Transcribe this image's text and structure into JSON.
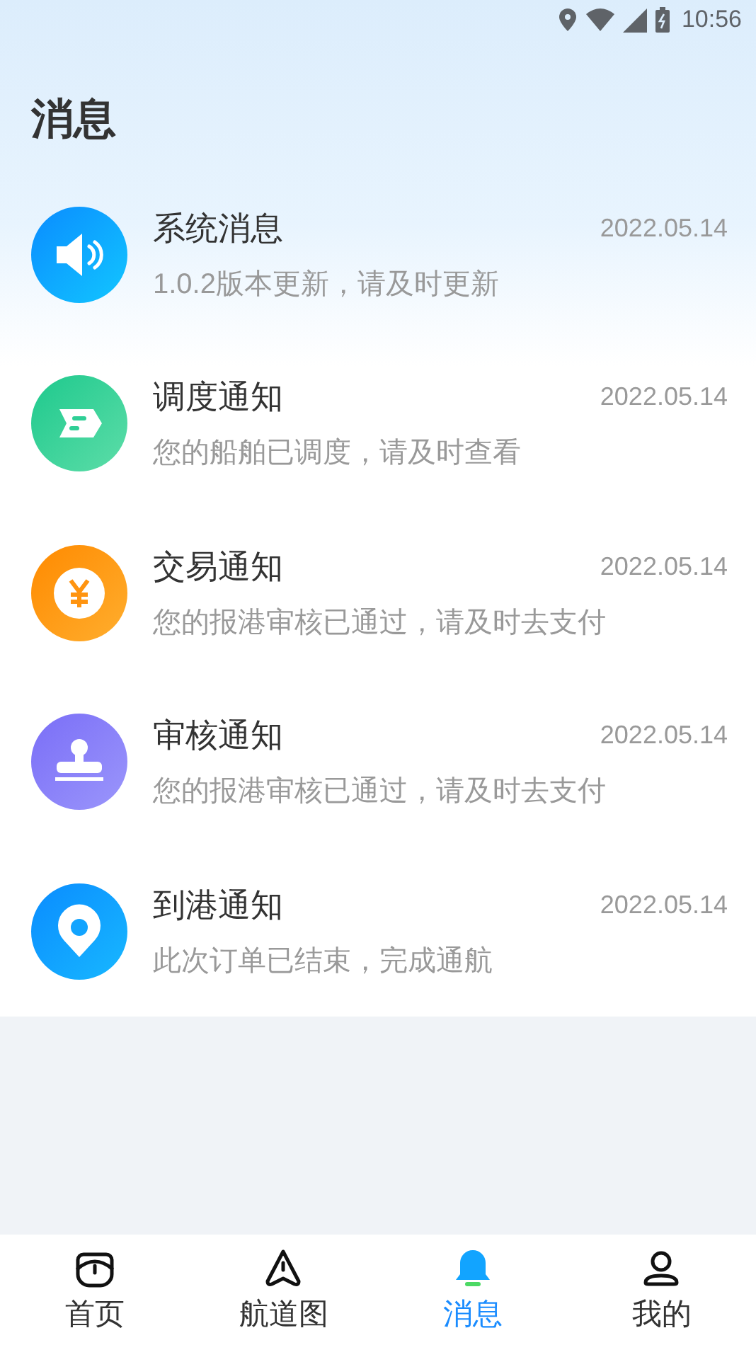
{
  "status_bar": {
    "time": "10:56"
  },
  "header": {
    "title": "消息"
  },
  "messages": [
    {
      "kind": "speaker",
      "title": "系统消息",
      "date": "2022.05.14",
      "body": "1.0.2版本更新，请及时更新"
    },
    {
      "kind": "dispatch",
      "title": "调度通知",
      "date": "2022.05.14",
      "body": "您的船舶已调度，请及时查看"
    },
    {
      "kind": "yen",
      "title": "交易通知",
      "date": "2022.05.14",
      "body": "您的报港审核已通过，请及时去支付"
    },
    {
      "kind": "stamp",
      "title": "审核通知",
      "date": "2022.05.14",
      "body": "您的报港审核已通过，请及时去支付"
    },
    {
      "kind": "pin",
      "title": "到港通知",
      "date": "2022.05.14",
      "body": "此次订单已结束，完成通航"
    }
  ],
  "tab_bar": [
    {
      "kind": "home",
      "label": "首页",
      "selected": false
    },
    {
      "kind": "route",
      "label": "航道图",
      "selected": false
    },
    {
      "kind": "bell",
      "label": "消息",
      "selected": true
    },
    {
      "kind": "user",
      "label": "我的",
      "selected": false
    }
  ]
}
